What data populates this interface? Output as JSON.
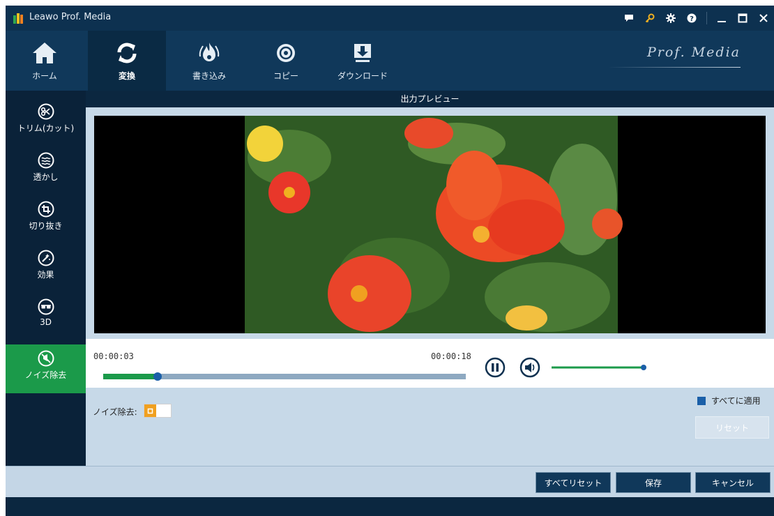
{
  "window": {
    "title": "Leawo Prof. Media"
  },
  "title_icons": [
    "chat-icon",
    "key-icon",
    "gear-icon",
    "help-icon",
    "minimize-icon",
    "maximize-icon",
    "close-icon"
  ],
  "toolbar": {
    "tabs": [
      {
        "label": "ホーム",
        "icon": "home-icon"
      },
      {
        "label": "変換",
        "icon": "convert-icon",
        "active": true
      },
      {
        "label": "書き込み",
        "icon": "burn-icon"
      },
      {
        "label": "コピー",
        "icon": "copy-disc-icon"
      },
      {
        "label": "ダウンロード",
        "icon": "download-icon"
      }
    ],
    "brand": "Prof. Media"
  },
  "sidebar": {
    "items": [
      {
        "label": "トリム(カット)",
        "icon": "scissors-icon"
      },
      {
        "label": "透かし",
        "icon": "watermark-icon"
      },
      {
        "label": "切り抜き",
        "icon": "crop-icon"
      },
      {
        "label": "効果",
        "icon": "effect-icon"
      },
      {
        "label": "3D",
        "icon": "3d-glasses-icon"
      },
      {
        "label": "ノイズ除去",
        "icon": "denoise-icon",
        "active": true
      }
    ]
  },
  "preview": {
    "title": "出力プレビュー",
    "current_time": "00:00:03",
    "total_time": "00:00:18",
    "progress": 0.15,
    "volume": 1.0
  },
  "settings": {
    "noise_label": "ノイズ除去:",
    "noise_enabled": false,
    "apply_all_label": "すべてに適用",
    "apply_all_checked": true,
    "reset_label": "リセット"
  },
  "footer": {
    "reset_all_label": "すべてリセット",
    "save_label": "保存",
    "cancel_label": "キャンセル"
  },
  "colors": {
    "accent_green": "#1b9a4a",
    "navy": "#10385a",
    "slider_blue": "#1a5fa8",
    "toggle_orange": "#f0a020"
  }
}
